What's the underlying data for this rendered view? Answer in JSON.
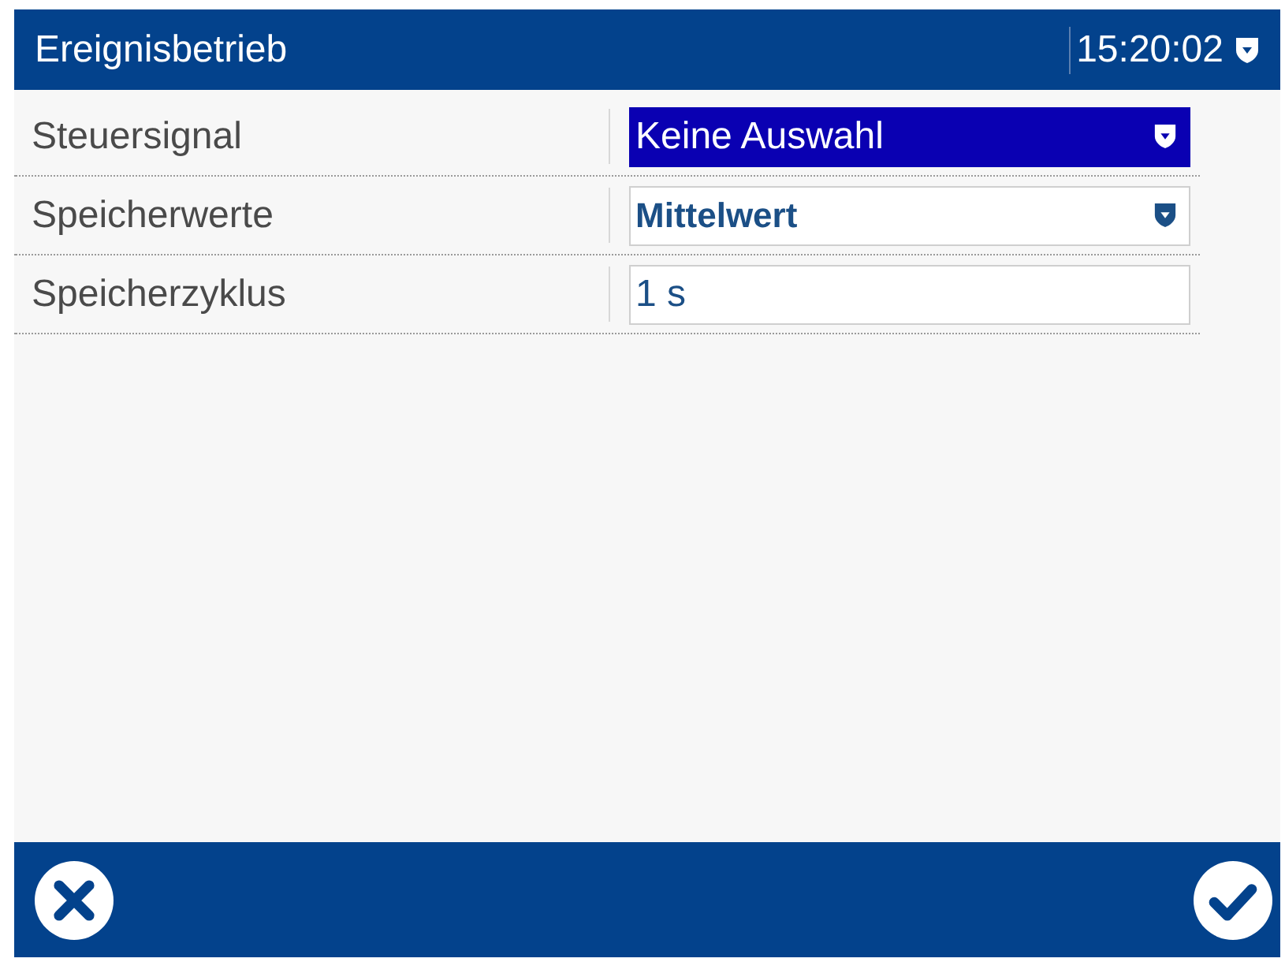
{
  "header": {
    "title": "Ereignisbetrieb",
    "time": "15:20:02"
  },
  "rows": [
    {
      "label": "Steuersignal",
      "kind": "dropdown",
      "value": "Keine Auswahl",
      "selected": true
    },
    {
      "label": "Speicherwerte",
      "kind": "dropdown",
      "value": "Mittelwert",
      "selected": false
    },
    {
      "label": "Speicherzyklus",
      "kind": "input",
      "value": "1 s",
      "selected": false
    }
  ],
  "footer": {
    "buttons": [
      {
        "kind": "cancel"
      },
      {
        "kind": "confirm"
      }
    ]
  }
}
